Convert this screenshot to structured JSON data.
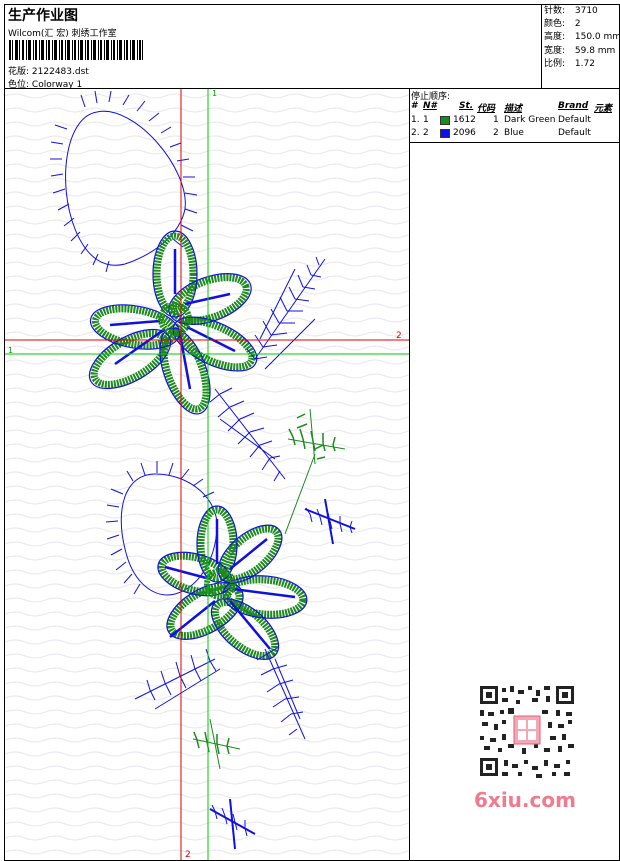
{
  "header": {
    "title": "生产作业图",
    "studio": "Wilcom(汇 宏) 刺绣工作室",
    "design_label": "花版:",
    "design_value": "2122483.dst",
    "colorway_label": "色位:",
    "colorway_value": "Colorway 1"
  },
  "stats": {
    "stitches_label": "针数:",
    "stitches_value": "3710",
    "colors_label": "颜色:",
    "colors_value": "2",
    "height_label": "高度:",
    "height_value": "150.0 mm",
    "width_label": "宽度:",
    "width_value": "59.8 mm",
    "scale_label": "比例:",
    "scale_value": "1.72"
  },
  "stop_sequence": {
    "heading": "停止顺序:",
    "columns": {
      "hash": "#",
      "no": "N#",
      "st": "St.",
      "code": "代码",
      "desc": "描述",
      "brand": "Brand",
      "element": "元素"
    },
    "rows": [
      {
        "hash": "1.",
        "no": "1",
        "color": "#1c8a1c",
        "st": "1612",
        "code": "1",
        "desc": "Dark Green",
        "brand": "Default"
      },
      {
        "hash": "2.",
        "no": "2",
        "color": "#1010e0",
        "st": "2096",
        "code": "2",
        "desc": "Blue",
        "brand": "Default"
      }
    ]
  },
  "crosshair": {
    "green_label_h": "1",
    "green_label_v": "1",
    "red_label_h": "2",
    "red_label_v": "2",
    "red_color": "#e00000",
    "green_color": "#00c800"
  },
  "watermark": {
    "text": "6xiu.com",
    "color": "#f07a8e"
  }
}
